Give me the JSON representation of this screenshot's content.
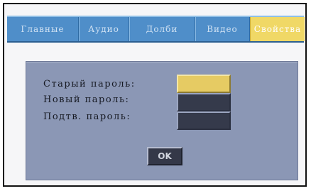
{
  "tabs": [
    {
      "label": "Главные",
      "active": false
    },
    {
      "label": "Аудио",
      "active": false
    },
    {
      "label": "Долби",
      "active": false
    },
    {
      "label": "Видео",
      "active": false
    },
    {
      "label": "Свойства",
      "active": true
    }
  ],
  "password_dialog": {
    "old_password_label": "Старый пароль:",
    "new_password_label": "Новый пароль:",
    "confirm_password_label": "Подтв. пароль:",
    "ok_label": "OK"
  },
  "colors": {
    "tab_bar": "#4f8ec9",
    "active_tab": "#f0d866",
    "dialog": "#8b97b5",
    "field": "#353a4b",
    "focused_field": "#e6cb63"
  }
}
